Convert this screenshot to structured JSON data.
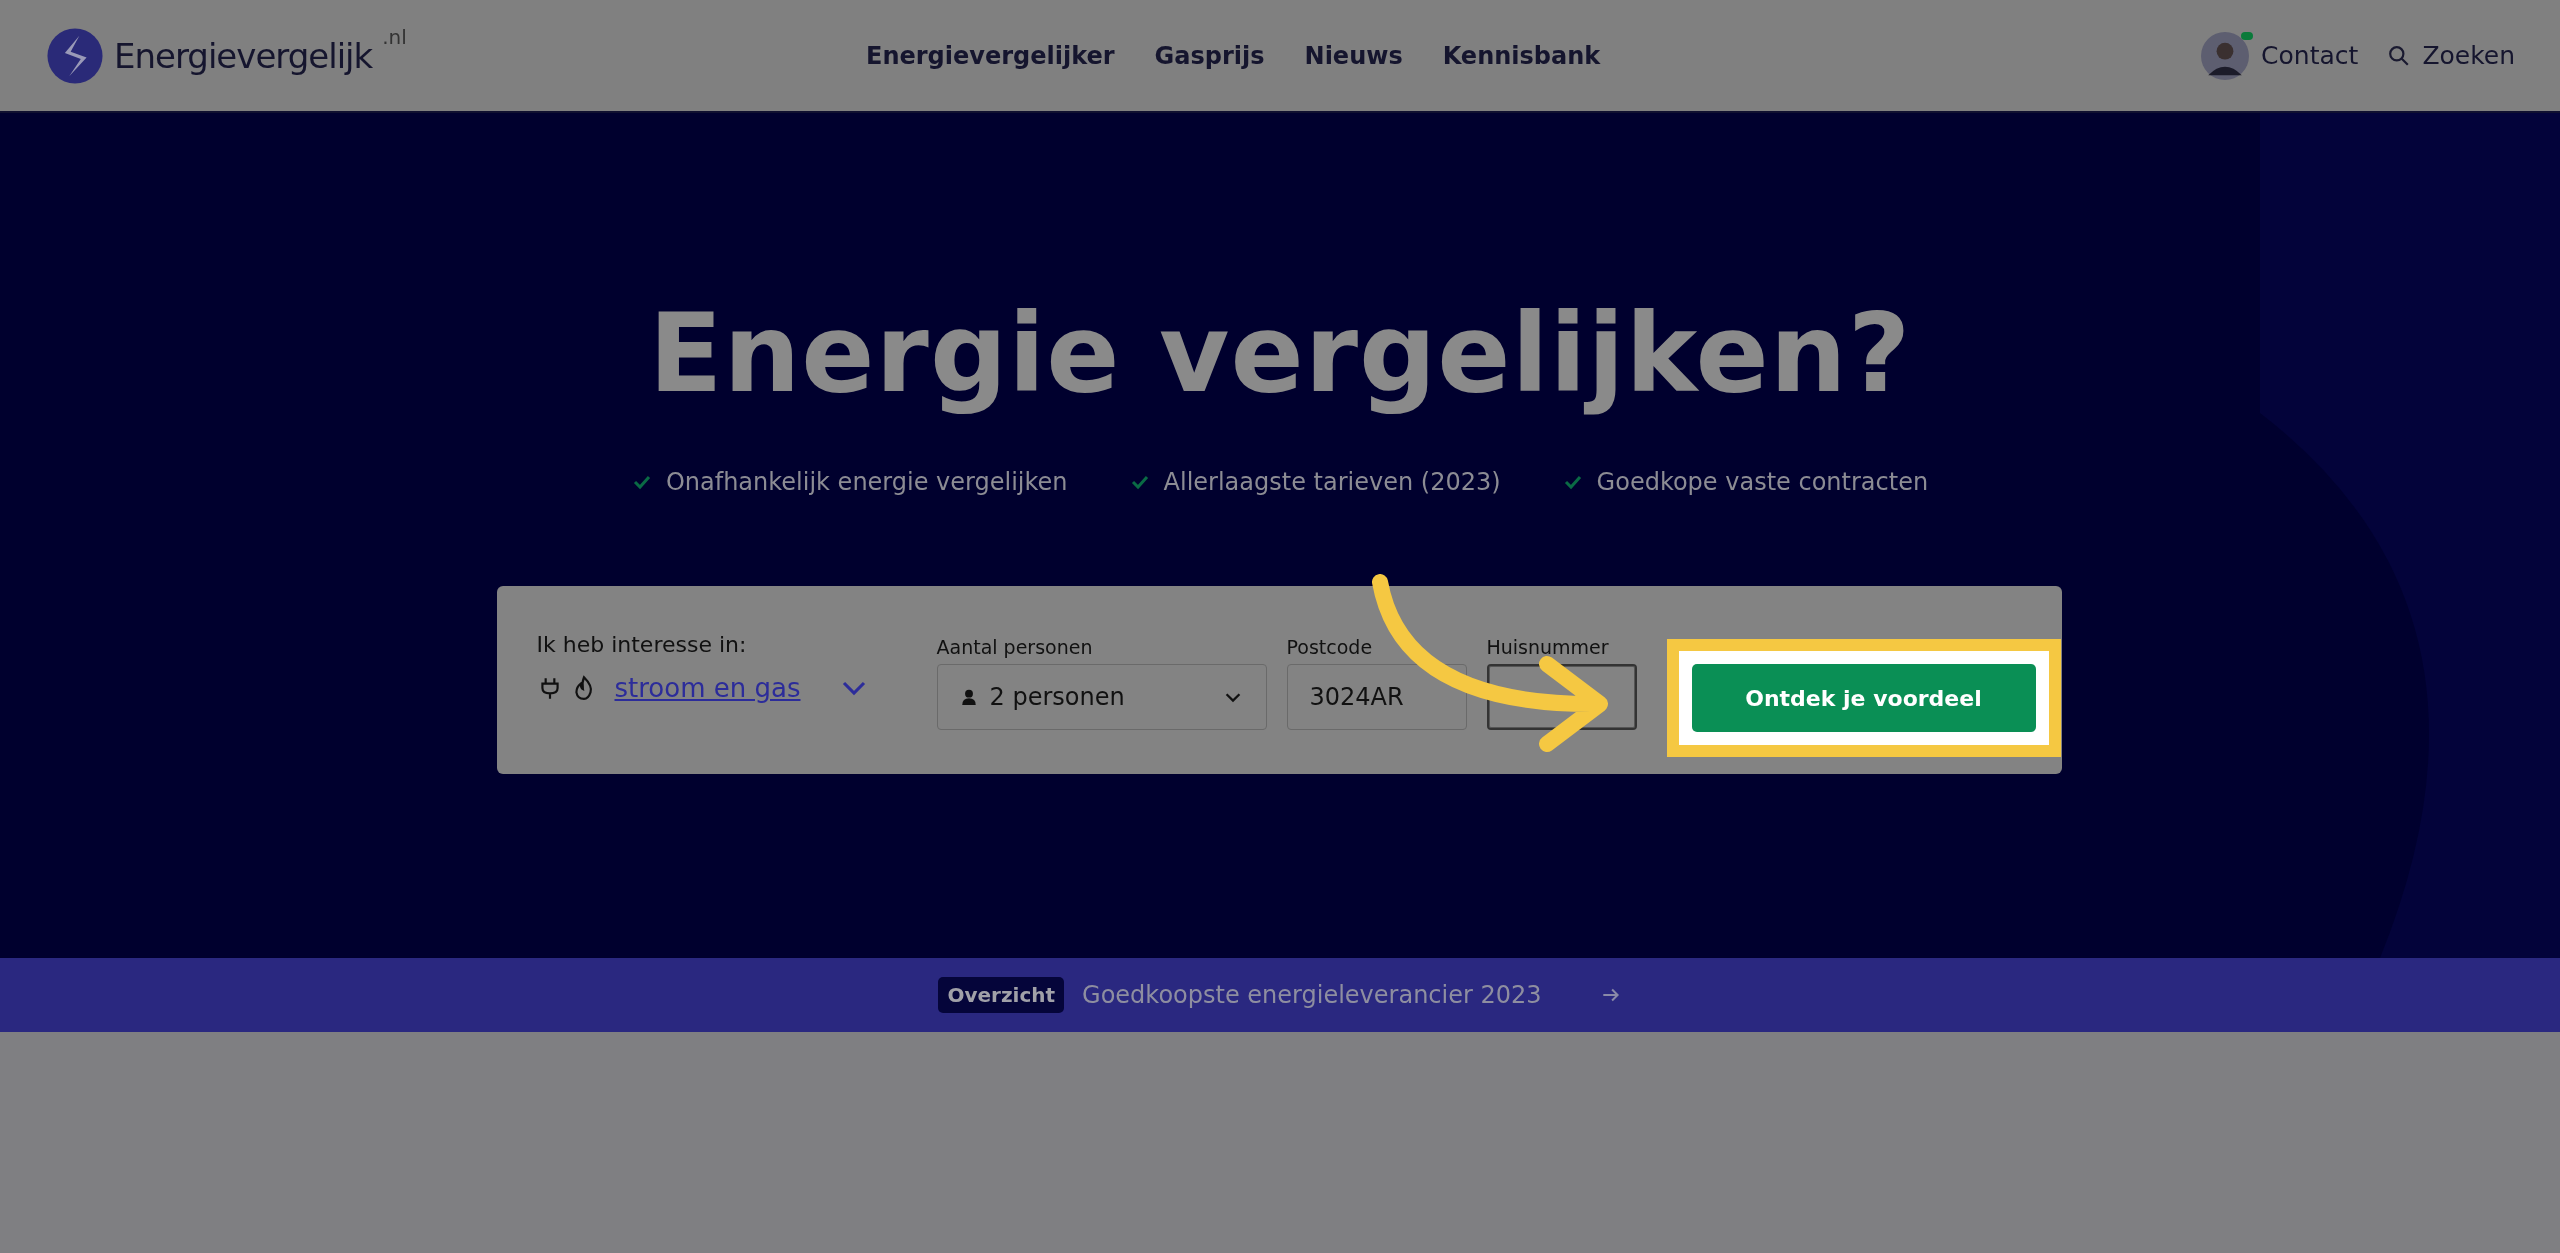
{
  "header": {
    "logo": {
      "name": "Energievergelijk",
      "suffix": ".nl"
    },
    "nav": [
      {
        "label": "Energievergelijker"
      },
      {
        "label": "Gasprijs"
      },
      {
        "label": "Nieuws"
      },
      {
        "label": "Kennisbank"
      }
    ],
    "contact": {
      "label": "Contact",
      "online": true
    },
    "search": {
      "label": "Zoeken"
    }
  },
  "hero": {
    "title": "Energie vergelijken?",
    "usps": [
      "Onafhankelijk energie vergelijken",
      "Allerlaagste tarieven (2023)",
      "Goedkope vaste contracten"
    ]
  },
  "form": {
    "interest_label": "Ik heb interesse in:",
    "interest_value": "stroom en gas",
    "fields": [
      {
        "kind": "select",
        "label": "Aantal personen",
        "value": "2 personen"
      },
      {
        "kind": "text",
        "label": "Postcode",
        "value": "3024AR"
      },
      {
        "kind": "text",
        "label": "Huisnummer",
        "focused": true
      }
    ],
    "submit": {
      "label": "Ontdek je voordeel",
      "highlighted": true
    }
  },
  "banner": {
    "badge": "Overzicht",
    "text": "Goedkoopste energieleverancier 2023"
  }
}
